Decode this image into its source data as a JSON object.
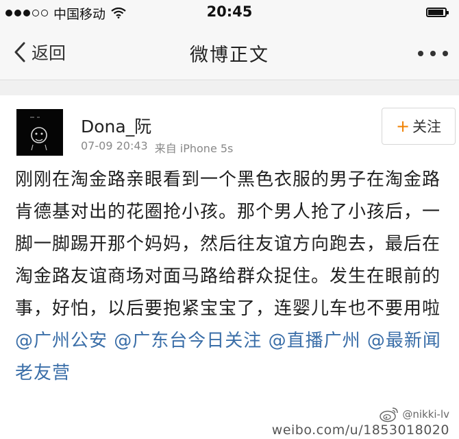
{
  "status_bar": {
    "carrier": "中国移动",
    "time": "20:45"
  },
  "nav": {
    "back_label": "返回",
    "title": "微博正文"
  },
  "post": {
    "username": "Dona_阮",
    "date": "07-09 20:43",
    "source": "来自 iPhone 5s",
    "follow_label": "关注",
    "body": "刚刚在淘金路亲眼看到一个黑色衣服的男子在淘金路肯德基对出的花圈抢小孩。那个男人抢了小孩后，一脚一脚踢开那个妈妈，然后往友谊方向跑去，最后在淘金路友谊商场对面马路给群众捉住。发生在眼前的事，好怕，以后要抱紧宝宝了，连婴儿车也不要用啦",
    "mentions": [
      "@广州公安",
      "@广东台今日关注",
      "@直播广州",
      "@最新闻老友营"
    ]
  },
  "watermark": {
    "handle": "@nikki-lv",
    "url": "weibo.com/u/1853018020"
  },
  "colors": {
    "mention": "#3a6ea8",
    "follow_plus": "#f08000"
  },
  "icons": [
    "signal-dots-icon",
    "wifi-icon",
    "battery-icon",
    "back-chevron-icon",
    "more-dots-icon",
    "plus-icon",
    "weibo-logo-icon"
  ]
}
